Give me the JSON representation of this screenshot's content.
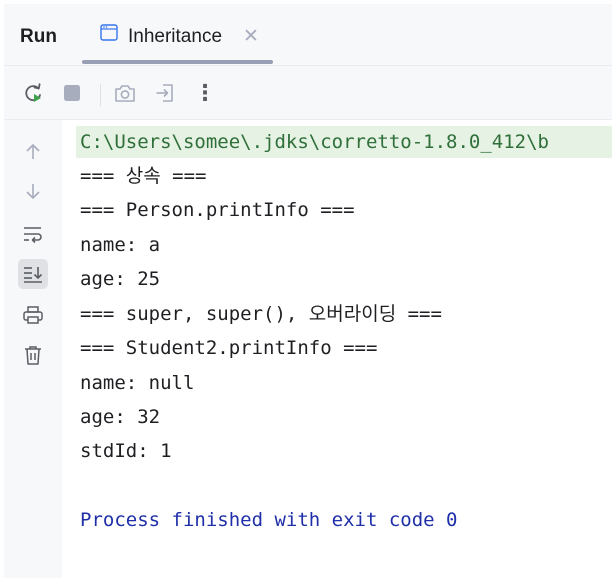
{
  "header": {
    "run_label": "Run",
    "tab": {
      "label": "Inheritance",
      "icon": "console-window-icon",
      "close": "✕"
    }
  },
  "toolbar": {
    "buttons": [
      "rerun-icon",
      "stop-icon",
      "screenshot-icon",
      "exit-icon",
      "more-icon"
    ],
    "more_label": "⋮"
  },
  "gutter": {
    "buttons": [
      "arrow-up-icon",
      "arrow-down-icon",
      "soft-wrap-icon",
      "scroll-to-end-icon",
      "print-icon",
      "trash-icon"
    ],
    "active": "scroll-to-end-icon"
  },
  "console": {
    "command": "C:\\Users\\somee\\.jdks\\corretto-1.8.0_412\\b",
    "lines": [
      "=== 상속 ===",
      "=== Person.printInfo ===",
      "name: a",
      "age: 25",
      "=== super, super(), 오버라이딩 ===",
      "=== Student2.printInfo ===",
      "name: null",
      "age: 32",
      "stdId: 1"
    ],
    "exit_message": "Process finished with exit code 0"
  },
  "colors": {
    "background": "#f7f8fa",
    "console_background": "#ffffff",
    "command_highlight": "#e6f2e3",
    "command_text": "#2f6f3a",
    "exit_text": "#1f2fa8",
    "rerun_accent": "#3fa34d"
  }
}
